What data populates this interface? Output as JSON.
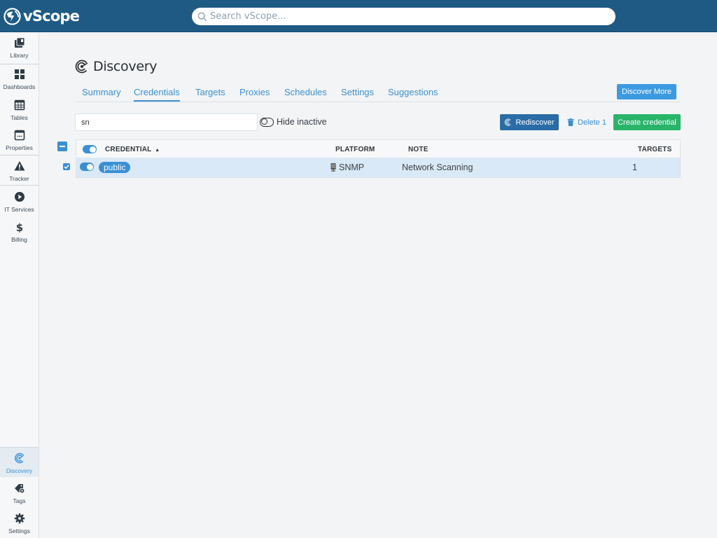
{
  "app": {
    "name": "vScope",
    "search_placeholder": "Search vScope..."
  },
  "colors": {
    "header": "#1e5a84",
    "accent": "#3a8fd3",
    "primary_button": "#3c9ae0",
    "rediscover_button": "#2a6ca6",
    "create_button": "#28b56a",
    "selected_row": "#d9e9f7"
  },
  "sidebar": {
    "items": [
      {
        "label": "Library",
        "icon": "library-icon"
      },
      {
        "label": "Dashboards",
        "icon": "dashboards-icon"
      },
      {
        "label": "Tables",
        "icon": "tables-icon"
      },
      {
        "label": "Properties",
        "icon": "properties-icon"
      },
      {
        "label": "Tracker",
        "icon": "warning-icon"
      },
      {
        "label": "IT Services",
        "icon": "play-circle-icon"
      },
      {
        "label": "Billing",
        "icon": "dollar-icon"
      }
    ],
    "bottom_items": [
      {
        "label": "Discovery",
        "icon": "discovery-icon",
        "active": true
      },
      {
        "label": "Tags",
        "icon": "tags-gear-icon"
      },
      {
        "label": "Settings",
        "icon": "gear-icon"
      }
    ]
  },
  "page": {
    "title": "Discovery",
    "tabs": [
      {
        "label": "Summary"
      },
      {
        "label": "Credentials",
        "active": true
      },
      {
        "label": "Targets"
      },
      {
        "label": "Proxies"
      },
      {
        "label": "Schedules"
      },
      {
        "label": "Settings"
      },
      {
        "label": "Suggestions"
      }
    ],
    "discover_more_label": "Discover More"
  },
  "toolbar": {
    "filter_value": "sn",
    "hide_inactive_label": "Hide inactive",
    "hide_inactive_on": false,
    "rediscover_label": "Rediscover",
    "delete_label": "Delete 1",
    "create_label": "Create credential"
  },
  "table": {
    "columns": {
      "credential": "CREDENTIAL",
      "sort_indicator": "▲",
      "platform": "PLATFORM",
      "note": "NOTE",
      "targets": "TARGETS"
    },
    "rows": [
      {
        "selected": true,
        "active": true,
        "credential": "public",
        "platform": "SNMP",
        "note": "Network Scanning",
        "targets": "1"
      }
    ]
  }
}
